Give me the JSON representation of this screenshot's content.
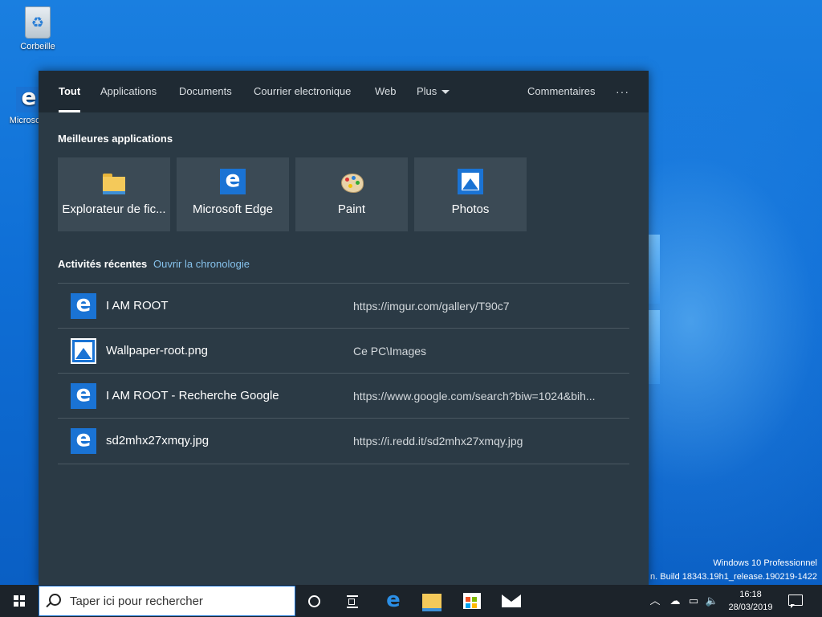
{
  "desktop": {
    "icons": [
      {
        "label": "Corbeille",
        "icon": "recycle-bin-icon"
      },
      {
        "label": "Microso",
        "icon": "edge-icon"
      }
    ],
    "edition": "Windows 10 Professionnel",
    "build": "n. Build 18343.19h1_release.190219-1422"
  },
  "search_panel": {
    "tabs": [
      {
        "label": "Tout",
        "active": true
      },
      {
        "label": "Applications"
      },
      {
        "label": "Documents"
      },
      {
        "label": "Courrier electronique"
      },
      {
        "label": "Web"
      },
      {
        "label": "Plus"
      }
    ],
    "feedback": "Commentaires",
    "more": "···",
    "best_apps": {
      "title": "Meilleures applications",
      "items": [
        {
          "label": "Explorateur de fic...",
          "icon": "file-explorer-icon"
        },
        {
          "label": "Microsoft Edge",
          "icon": "edge-icon"
        },
        {
          "label": "Paint",
          "icon": "paint-icon"
        },
        {
          "label": "Photos",
          "icon": "photos-icon"
        }
      ]
    },
    "recent": {
      "title": "Activités récentes",
      "timeline_link": "Ouvrir la chronologie",
      "items": [
        {
          "name": "I AM ROOT",
          "location": "https://imgur.com/gallery/T90c7",
          "icon": "edge-icon"
        },
        {
          "name": "Wallpaper-root.png",
          "location": "Ce PC\\Images",
          "icon": "image-file-icon"
        },
        {
          "name": "I AM ROOT - Recherche Google",
          "location": "https://www.google.com/search?biw=1024&bih...",
          "icon": "edge-icon"
        },
        {
          "name": "sd2mhx27xmqy.jpg",
          "location": "https://i.redd.it/sd2mhx27xmqy.jpg",
          "icon": "edge-icon"
        }
      ]
    }
  },
  "taskbar": {
    "search_placeholder": "Taper ici pour rechercher",
    "time": "16:18",
    "date": "28/03/2019"
  },
  "colors": {
    "accent": "#1a73d4",
    "panel_bg": "#2b3a45",
    "nav_bg": "#1f2a33",
    "taskbar_bg": "#1c232a",
    "link": "#86c2ec"
  }
}
